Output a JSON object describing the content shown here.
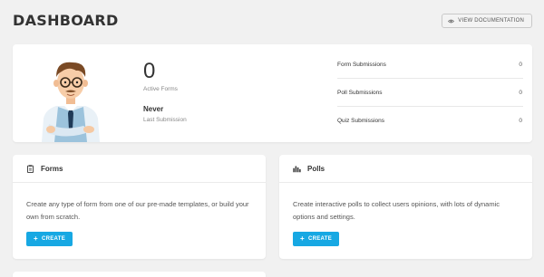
{
  "header": {
    "title": "DASHBOARD",
    "doc_button_label": "VIEW DOCUMENTATION",
    "doc_button_icon": "eye-icon"
  },
  "summary": {
    "active_forms_count": "0",
    "active_forms_label": "Active Forms",
    "last_submission_value": "Never",
    "last_submission_label": "Last Submission",
    "submissions": [
      {
        "label": "Form Submissions",
        "count": "0"
      },
      {
        "label": "Poll Submissions",
        "count": "0"
      },
      {
        "label": "Quiz Submissions",
        "count": "0"
      }
    ]
  },
  "modules": {
    "forms": {
      "title": "Forms",
      "icon": "clipboard-icon",
      "description": "Create any type of form from one of our pre-made templates, or build your own from scratch.",
      "button_label": "CREATE"
    },
    "polls": {
      "title": "Polls",
      "icon": "bar-chart-icon",
      "description": "Create interactive polls to collect users opinions, with lots of dynamic options and settings.",
      "button_label": "CREATE"
    }
  },
  "colors": {
    "accent": "#17a8e3",
    "background": "#f1f1f1"
  }
}
